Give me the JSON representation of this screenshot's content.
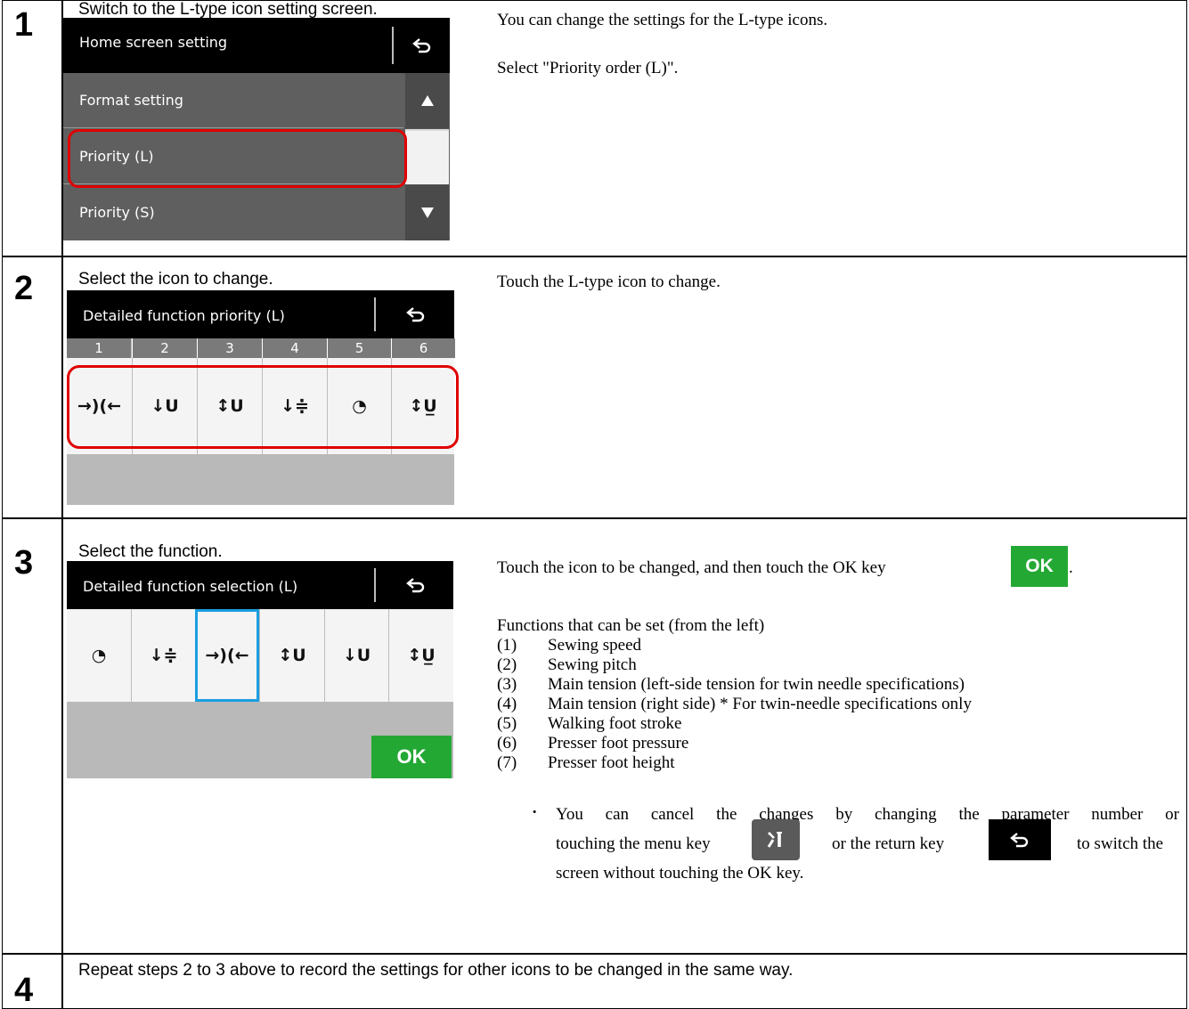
{
  "steps": [
    {
      "number": "1",
      "title": "Switch to the L-type icon setting screen.",
      "screen": {
        "header_title": "Home screen setting",
        "items": [
          "Format setting",
          "Priority (L)",
          "Priority (S)"
        ],
        "highlighted_item": "Priority (L)"
      },
      "desc": [
        "You can change the settings for the L-type icons.",
        "Select \"Priority order (L)\"."
      ]
    },
    {
      "number": "2",
      "title": "Select the icon to change.",
      "screen": {
        "header_title": "Detailed function priority (L)",
        "columns": [
          "1",
          "2",
          "3",
          "4",
          "5",
          "6"
        ],
        "icons": [
          "→)(←",
          "↓U",
          "↕U",
          "↓≑",
          "◔",
          "↕U̲"
        ]
      },
      "desc": [
        "Touch the L-type icon to change."
      ]
    },
    {
      "number": "3",
      "title": "Select the function.",
      "screen": {
        "header_title": "Detailed function selection (L)",
        "icons": [
          "◔",
          "↓≑",
          "→)(←",
          "↕U",
          "↓U",
          "↕U̲"
        ],
        "selected_index": 2,
        "ok_label": "OK"
      },
      "desc_lead": "Touch the icon to be changed, and then touch the OK key",
      "desc_lead_end": ".",
      "functions_heading": "Functions that can be set (from the left)",
      "functions": [
        {
          "n": "(1)",
          "text": "Sewing speed"
        },
        {
          "n": "(2)",
          "text": "Sewing pitch"
        },
        {
          "n": "(3)",
          "text": "Main tension (left-side tension for twin needle specifications)"
        },
        {
          "n": "(4)",
          "text": "Main tension (right side) * For twin-needle specifications only"
        },
        {
          "n": "(5)",
          "text": "Walking foot stroke"
        },
        {
          "n": "(6)",
          "text": "Presser foot pressure"
        },
        {
          "n": "(7)",
          "text": "Presser foot height"
        }
      ],
      "note": {
        "bullet": "·",
        "line1": "You can cancel the changes by changing the parameter number or",
        "line2a": "touching the menu key",
        "line2b": "or the return key",
        "line2c": "to switch the",
        "line3": "screen without touching the OK key."
      },
      "ok_key_label": "OK"
    },
    {
      "number": "4",
      "title": "Repeat steps 2 to 3 above to record the settings for other icons to be changed in the same way."
    }
  ],
  "colors": {
    "highlight": "#e00000",
    "selected": "#1a9ee0",
    "ok": "#24a834",
    "header": "#000000"
  }
}
